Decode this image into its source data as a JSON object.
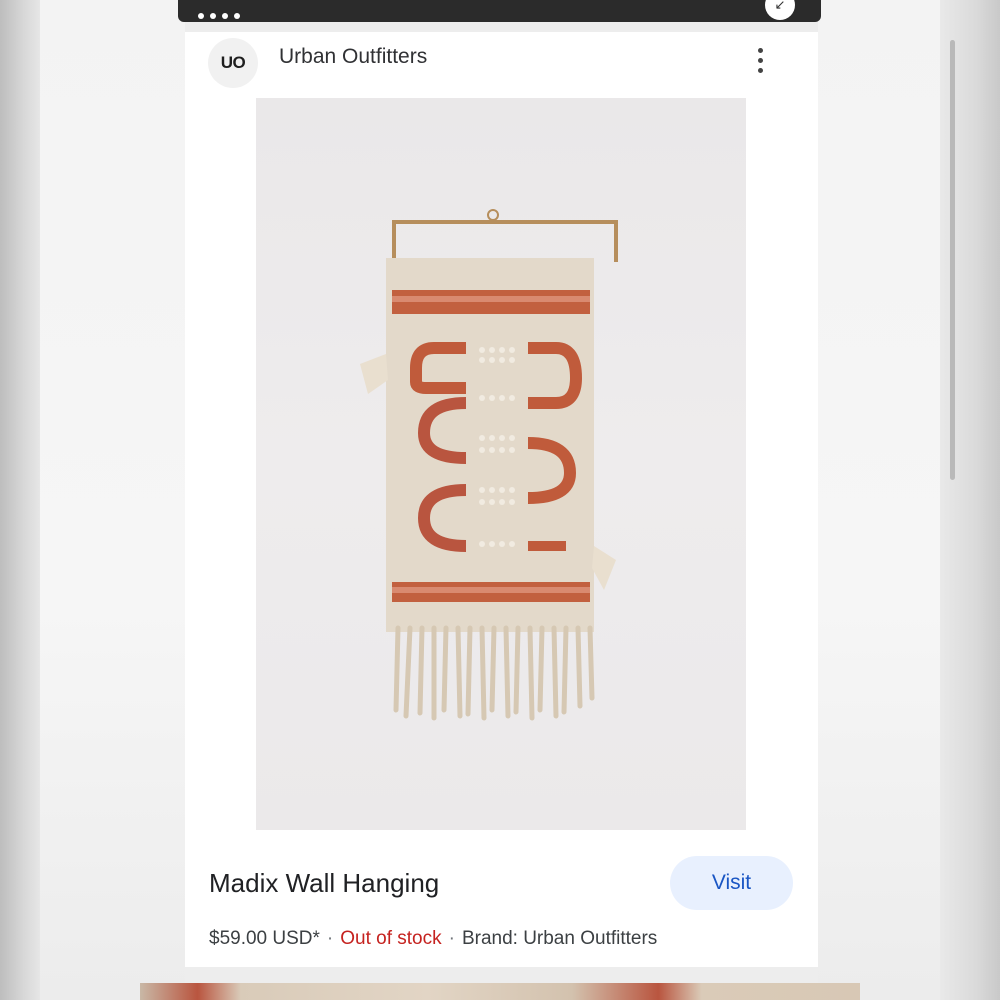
{
  "card": {
    "site_logo_text": "UO",
    "site_name": "Urban Outfitters",
    "product_title": "Madix Wall Hanging",
    "visit_label": "Visit",
    "price": "$59.00 USD*",
    "stock_status": "Out of stock",
    "brand": "Brand: Urban Outfitters",
    "separator": "·"
  },
  "colors": {
    "stock_red": "#c5221f",
    "visit_bg": "#e8f0fe",
    "visit_text": "#1a56c4",
    "weave_rust": "#b9553f",
    "weave_cream": "#e6dccd"
  },
  "icons": {
    "more": "more-vert-icon",
    "expand": "expand-arrow-icon"
  }
}
